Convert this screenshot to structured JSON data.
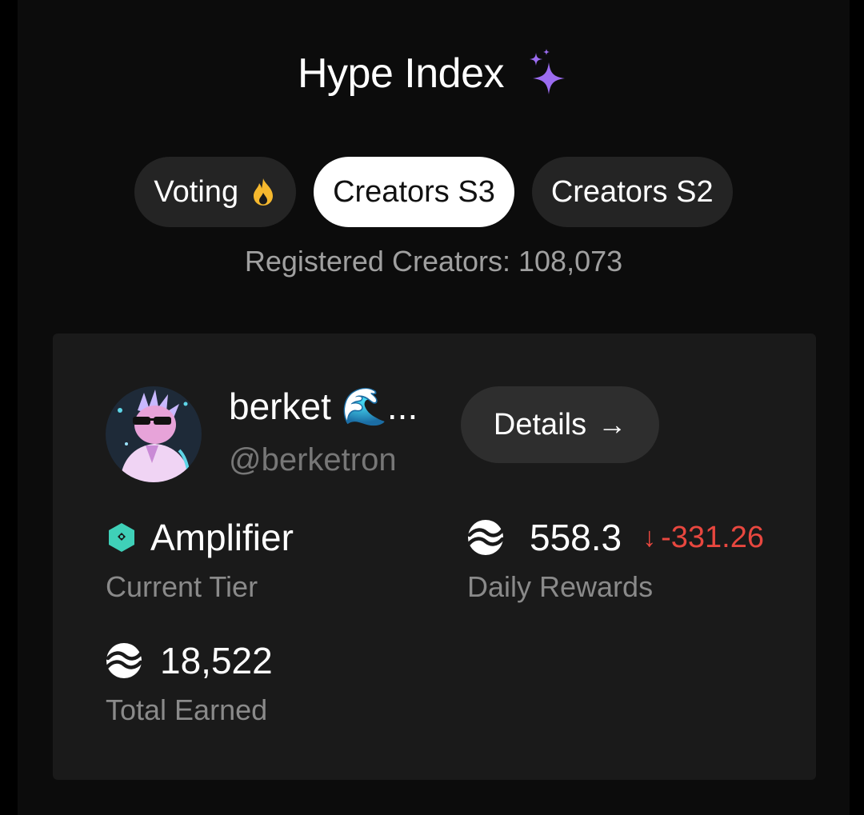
{
  "header": {
    "title": "Hype Index",
    "title_icon": "sparkles-icon"
  },
  "tabs": [
    {
      "label": "Voting",
      "icon": "fire-icon",
      "active": false
    },
    {
      "label": "Creators S3",
      "active": true
    },
    {
      "label": "Creators S2",
      "active": false
    }
  ],
  "registered_text": "Registered Creators: 108,073",
  "creator": {
    "display_name": "berket 🌊...",
    "handle": "@berketron",
    "details_label": "Details",
    "details_icon": "arrow-right-icon",
    "tier": {
      "value": "Amplifier",
      "label": "Current Tier",
      "icon": "hexagon-tier-icon"
    },
    "daily_rewards": {
      "value": "558.3",
      "delta": "-331.26",
      "label": "Daily Rewards",
      "icon": "token-icon"
    },
    "total_earned": {
      "value": "18,522",
      "label": "Total Earned",
      "icon": "token-icon"
    }
  },
  "colors": {
    "background": "#0c0c0c",
    "card": "#1a1a1a",
    "accent_purple": "#9b6cf0",
    "negative": "#e8473f",
    "tier_teal": "#3fd0b8"
  }
}
